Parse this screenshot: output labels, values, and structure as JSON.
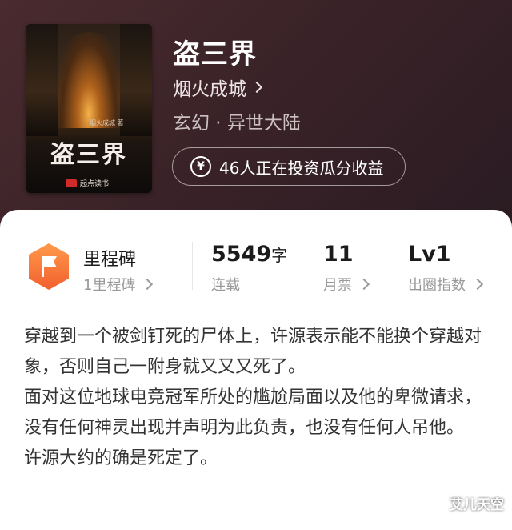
{
  "book": {
    "cover_title": "盗三界",
    "cover_author": "烟火成城 著",
    "cover_publisher": "起点读书",
    "title": "盗三界",
    "author": "烟火成城",
    "genre": "玄幻 · 异世大陆",
    "invest_text": "46人正在投资瓜分收益",
    "invest_icon": "yen-icon"
  },
  "stats": {
    "milestone_title": "里程碑",
    "milestone_sub": "1里程碑",
    "words_value": "5549",
    "words_unit": "字",
    "words_label": "连载",
    "tickets_value": "11",
    "tickets_label": "月票",
    "level_value": "Lv1",
    "level_label": "出圈指数"
  },
  "description": [
    "穿越到一个被剑钉死的尸体上，许源表示能不能换个穿越对象，否则自己一附身就又又又死了。",
    "面对这位地球电竞冠军所处的尴尬局面以及他的卑微请求，没有任何神灵出现并声明为此负责，也没有任何人吊他。",
    "许源大约的确是死定了。"
  ],
  "watermark": "艾儿天空",
  "colors": {
    "header_bg": "#3c2429",
    "accent_orange": "#f0703a"
  }
}
